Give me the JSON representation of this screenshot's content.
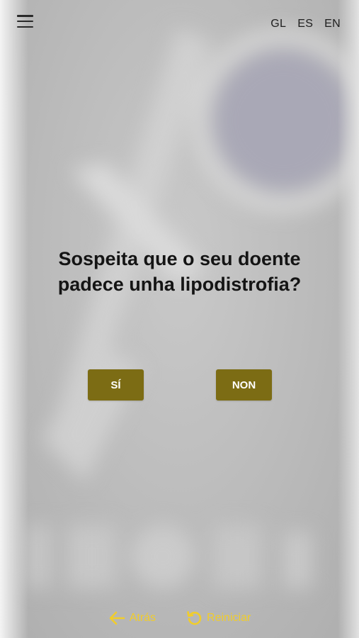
{
  "header": {
    "languages": [
      {
        "code": "GL"
      },
      {
        "code": "ES"
      },
      {
        "code": "EN"
      }
    ],
    "menu_icon": "hamburger-menu-icon"
  },
  "question": {
    "line1": "Sospeita que o seu doente",
    "line2": "padece unha lipodistrofia?"
  },
  "answers": {
    "yes": "SÍ",
    "no": "NON"
  },
  "footer": {
    "back": {
      "label": "Atrás",
      "icon": "arrow-left-icon"
    },
    "restart": {
      "label": "Reiniciar",
      "icon": "restart-icon"
    }
  },
  "colors": {
    "button": "#7c6c14",
    "footer_accent": "#f1cd2a"
  }
}
